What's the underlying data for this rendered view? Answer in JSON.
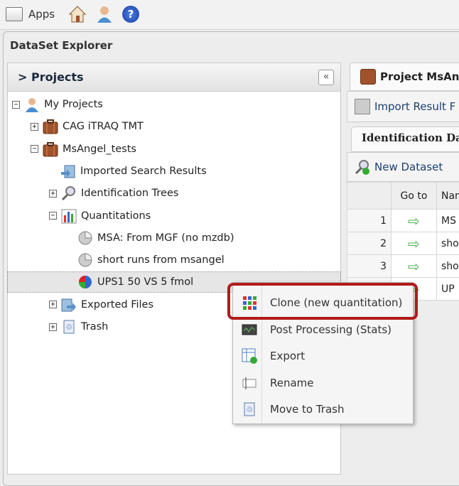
{
  "toolbar": {
    "apps_label": "Apps",
    "icons": [
      "home-icon",
      "user-icon",
      "help-icon"
    ]
  },
  "explorer": {
    "title": "DataSet Explorer"
  },
  "projects": {
    "header": "> Projects",
    "collapse_label": "«",
    "tree": [
      {
        "label": "My Projects",
        "icon": "user-icon",
        "toggle": "-"
      },
      {
        "label": "CAG iTRAQ TMT",
        "icon": "briefcase-icon",
        "toggle": "+"
      },
      {
        "label": "MsAngel_tests",
        "icon": "briefcase-icon",
        "toggle": "-"
      },
      {
        "label": "Imported Search Results",
        "icon": "import-icon",
        "toggle": ""
      },
      {
        "label": "Identification Trees",
        "icon": "magnifier-icon",
        "toggle": "+"
      },
      {
        "label": "Quantitations",
        "icon": "bar-chart-icon",
        "toggle": "-"
      },
      {
        "label": "MSA: From MGF (no mzdb)",
        "icon": "pie-grey-icon",
        "toggle": ""
      },
      {
        "label": "short runs from msangel",
        "icon": "pie-grey-icon",
        "toggle": ""
      },
      {
        "label": "UPS1 50 VS 5 fmol",
        "icon": "pie-color-icon",
        "toggle": "",
        "selected": true
      },
      {
        "label": "Exported Files",
        "icon": "export-icon",
        "toggle": "+"
      },
      {
        "label": "Trash",
        "icon": "trash-icon",
        "toggle": "+"
      }
    ]
  },
  "right": {
    "tab": "Project MsAn",
    "import_label": "Import Result F",
    "subtab": "Identification Da",
    "new_dataset": "New Dataset",
    "columns": [
      "",
      "Go to",
      "Nar"
    ],
    "rows": [
      [
        "1",
        "⇨",
        "MS"
      ],
      [
        "2",
        "⇨",
        "sho"
      ],
      [
        "3",
        "⇨",
        "sho"
      ],
      [
        "4",
        "⇨",
        "UP"
      ]
    ]
  },
  "context_menu": {
    "items": [
      {
        "label": "Clone (new quantitation)",
        "icon": "grid-icon",
        "highlighted": true
      },
      {
        "label": "Post Processing (Stats)",
        "icon": "stats-icon"
      },
      {
        "label": "Export",
        "icon": "export-table-icon"
      },
      {
        "label": "Rename",
        "icon": "rename-icon"
      },
      {
        "label": "Move to Trash",
        "icon": "trash-icon"
      }
    ]
  },
  "colors": {
    "highlight": "#b11a1a",
    "arrow": "#4caf50"
  }
}
